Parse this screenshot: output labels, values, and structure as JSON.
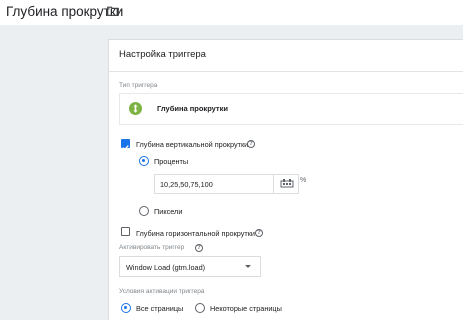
{
  "header": {
    "title": "Глубина прокрутки",
    "folder_icon": "folder-icon"
  },
  "card": {
    "title": "Настройка триггера",
    "trigger_type_label": "Тип триггера",
    "trigger_type_name": "Глубина прокрутки",
    "trigger_type_icon": "scroll-depth-icon",
    "trigger_type_color": "#7cb342",
    "vertical": {
      "label": "Глубина вертикальной прокрутки",
      "checked": true,
      "units": [
        {
          "label": "Проценты",
          "selected": true
        },
        {
          "label": "Пиксели",
          "selected": false
        }
      ],
      "value": "10,25,50,75,100",
      "unit_suffix": "%"
    },
    "horizontal": {
      "label": "Глубина горизонтальной прокрутки",
      "checked": false
    },
    "fire_on": {
      "label": "Активировать триггер",
      "value": "Window Load (gtm.load)"
    },
    "activation": {
      "label": "Условия активации триггера",
      "options": [
        {
          "label": "Все страницы",
          "selected": true
        },
        {
          "label": "Некоторые страницы",
          "selected": false
        }
      ]
    }
  },
  "colors": {
    "accent": "#1a73e8",
    "background": "#eceff1"
  }
}
